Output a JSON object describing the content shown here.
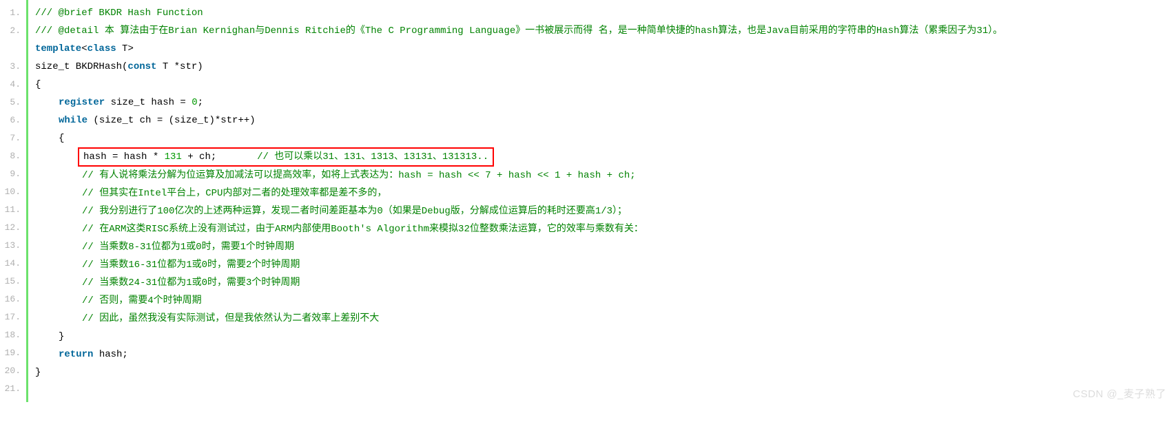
{
  "watermark": "CSDN @_麦子熟了",
  "lines": {
    "l1": {
      "c": "/// @brief BKDR Hash Function"
    },
    "l2": {
      "c": "/// @detail 本 算法由于在Brian Kernighan与Dennis Ritchie的《The C Programming Language》一书被展示而得 名，是一种简单快捷的hash算法，也是Java目前采用的字符串的Hash算法（累乘因子为31）。"
    },
    "l3": {
      "kw1": "template",
      "p1": "<",
      "kw2": "class",
      "p2": " T>"
    },
    "l4": {
      "p1": "size_t BKDRHash(",
      "kw1": "const",
      "p2": " T *str)"
    },
    "l5": {
      "p1": "{"
    },
    "l6": {
      "kw1": "register",
      "p1": " size_t hash = ",
      "n1": "0",
      "p2": ";"
    },
    "l7": {
      "kw1": "while",
      "p1": " (size_t ch = (size_t)*str++)"
    },
    "l8": {
      "p1": "{"
    },
    "l9": {
      "code": "hash = hash * ",
      "n1": "131",
      "code2": " + ch;",
      "gap": "       ",
      "c": "// 也可以乘以31、131、1313、13131、131313.."
    },
    "l10": {
      "c": "// 有人说将乘法分解为位运算及加减法可以提高效率，如将上式表达为：hash = hash << 7 + hash << 1 + hash + ch;"
    },
    "l11": {
      "c": "// 但其实在Intel平台上，CPU内部对二者的处理效率都是差不多的，"
    },
    "l12": {
      "c": "// 我分别进行了100亿次的上述两种运算，发现二者时间差距基本为0（如果是Debug版，分解成位运算后的耗时还要高1/3）；"
    },
    "l13": {
      "c": "// 在ARM这类RISC系统上没有测试过，由于ARM内部使用Booth's Algorithm来模拟32位整数乘法运算，它的效率与乘数有关："
    },
    "l14": {
      "c": "// 当乘数8-31位都为1或0时，需要1个时钟周期"
    },
    "l15": {
      "c": "// 当乘数16-31位都为1或0时，需要2个时钟周期"
    },
    "l16": {
      "c": "// 当乘数24-31位都为1或0时，需要3个时钟周期"
    },
    "l17": {
      "c": "// 否则，需要4个时钟周期"
    },
    "l18": {
      "c": "// 因此，虽然我没有实际测试，但是我依然认为二者效率上差别不大"
    },
    "l19": {
      "p1": "}"
    },
    "l20": {
      "kw1": "return",
      "p1": " hash;"
    },
    "l21": {
      "p1": "}"
    }
  },
  "linenums": [
    "1.",
    "2.",
    "3.",
    "4.",
    "5.",
    "6.",
    "7.",
    "8.",
    "9.",
    "10.",
    "11.",
    "12.",
    "13.",
    "14.",
    "15.",
    "16.",
    "17.",
    "18.",
    "19.",
    "20.",
    "21."
  ]
}
